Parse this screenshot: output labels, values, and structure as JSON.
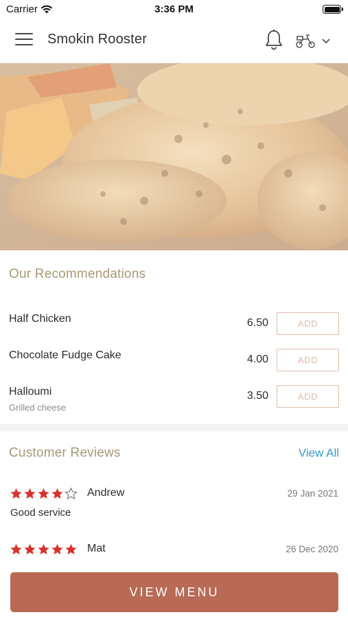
{
  "status": {
    "carrier": "Carrier",
    "time": "3:36 PM"
  },
  "header": {
    "title": "Smokin Rooster",
    "icons": [
      "menu-icon",
      "bell-icon",
      "scooter-icon",
      "chevron-down-icon"
    ]
  },
  "colors": {
    "accent": "#b86a55",
    "section_title": "#a89a74",
    "link": "#3a9bc7",
    "add_border": "#e2b8ad",
    "star": "#d9322c"
  },
  "recommendations": {
    "title": "Our Recommendations",
    "add_label": "ADD",
    "items": [
      {
        "name": "Half Chicken",
        "subtitle": "",
        "price": "6.50"
      },
      {
        "name": "Chocolate Fudge Cake",
        "subtitle": "",
        "price": "4.00"
      },
      {
        "name": "Halloumi",
        "subtitle": "Grilled cheese",
        "price": "3.50"
      }
    ]
  },
  "reviews": {
    "title": "Customer Reviews",
    "view_all": "View All",
    "items": [
      {
        "name": "Andrew",
        "date": "29 Jan 2021",
        "rating": 4,
        "text": "Good service"
      },
      {
        "name": "Mat",
        "date": "26 Dec 2020",
        "rating": 5,
        "text": ""
      }
    ]
  },
  "cta": {
    "label": "VIEW MENU"
  }
}
